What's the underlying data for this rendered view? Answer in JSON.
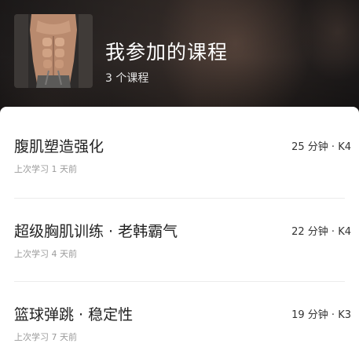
{
  "header": {
    "title": "我参加的课程",
    "subtitle": "3 个课程",
    "cover_image": "abs-muscle-photo"
  },
  "courses": [
    {
      "name": "腹肌塑造强化",
      "meta": "25 分钟 · K4",
      "last_studied": "上次学习 1 天前"
    },
    {
      "name": "超级胸肌训练 · 老韩霸气",
      "meta": "22 分钟 · K4",
      "last_studied": "上次学习 4 天前"
    },
    {
      "name": "篮球弹跳 · 稳定性",
      "meta": "19 分钟 · K3",
      "last_studied": "上次学习 7 天前"
    }
  ]
}
